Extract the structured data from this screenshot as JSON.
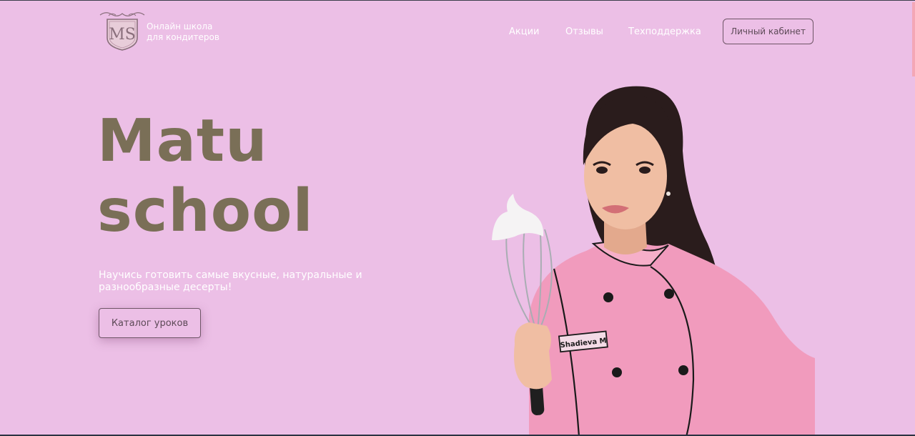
{
  "header": {
    "logo_monogram": "MS",
    "school_line1": "Онлайн школа",
    "school_line2": "для кондитеров",
    "nav": [
      "Акции",
      "Отзывы",
      "Техподдержка"
    ],
    "cabinet_label": "Личный кабинет"
  },
  "hero": {
    "title_line1": "Matu",
    "title_line2": "school",
    "subtitle_line1": "Научись готовить самые вкусные, натуральные и",
    "subtitle_line2": "разнообразные десерты!",
    "cta_label": "Каталог уроков",
    "name_tag": "Shadieva M"
  },
  "colors": {
    "background": "#ecbfe6",
    "title": "#7a6f57",
    "jacket": "#f19bbd",
    "button_border": "#6e5566"
  }
}
